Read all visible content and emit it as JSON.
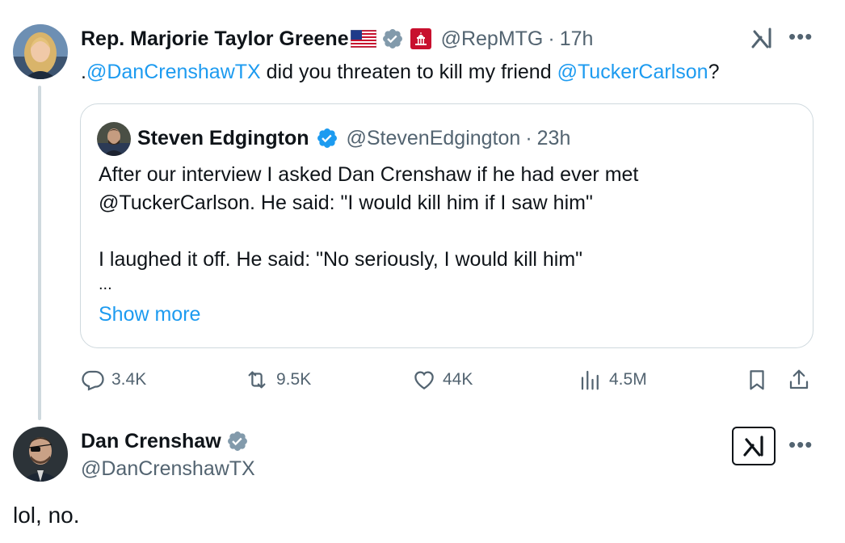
{
  "main_tweet": {
    "author_name": "Rep. Marjorie Taylor Greene",
    "handle": "@RepMTG",
    "separator": "·",
    "time": "17h",
    "text_prefix": ".",
    "mention_1": "@DanCrenshawTX",
    "text_middle": " did you threaten to kill my friend ",
    "mention_2": "@TuckerCarlson",
    "text_suffix": "?",
    "icons": [
      "us-flag-icon",
      "verified-gray-icon",
      "capitol-affiliation-icon",
      "grok-icon",
      "more-icon"
    ]
  },
  "quoted_tweet": {
    "author_name": "Steven Edgington",
    "handle": "@StevenEdgington",
    "separator": "·",
    "time": "23h",
    "line_1": "After our interview I asked Dan Crenshaw if he had ever met",
    "line_2": "@TuckerCarlson. He said: \"I would kill him if I saw him\"",
    "line_3": "I laughed it off. He said: \"No seriously, I would kill him\"",
    "ellipsis": "...",
    "show_more": "Show more"
  },
  "actions": {
    "replies": "3.4K",
    "reposts": "9.5K",
    "likes": "44K",
    "views": "4.5M"
  },
  "reply_tweet": {
    "author_name": "Dan Crenshaw",
    "handle": "@DanCrenshawTX",
    "text": "lol, no."
  },
  "colors": {
    "link": "#1d9bf0",
    "secondary_text": "#536471",
    "verified_gray": "#829aab",
    "verified_blue": "#1d9bf0",
    "border": "#cfd9de"
  }
}
